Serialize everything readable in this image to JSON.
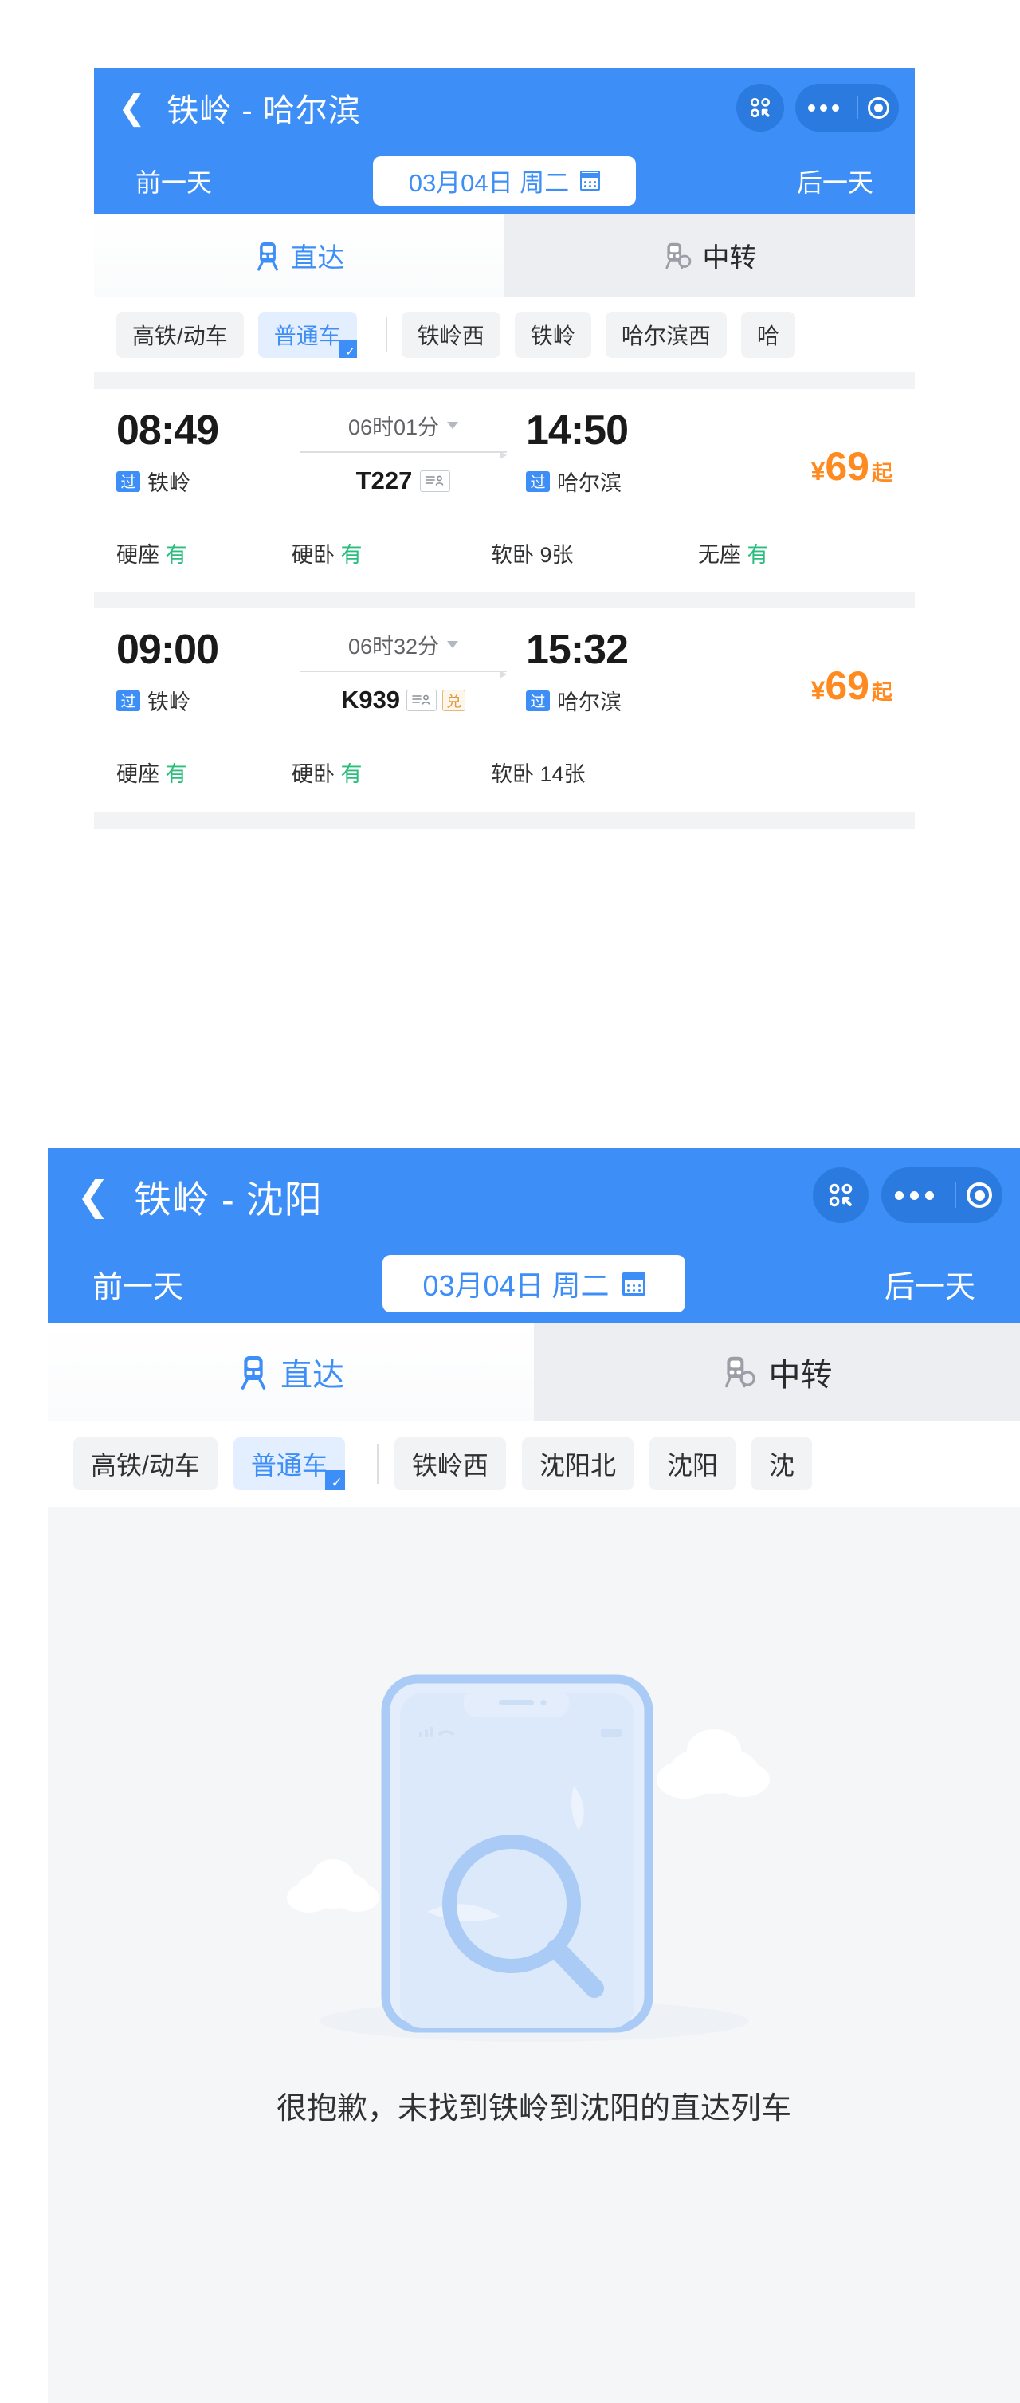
{
  "screens": [
    {
      "id": "harbin",
      "header": {
        "back_icon": "chevron-left-icon",
        "title": "铁岭 - 哈尔滨",
        "capsule": {
          "menu_icon": "mini-program-menu-icon",
          "more_icon": "more-dots-icon",
          "close_icon": "target-circle-icon"
        }
      },
      "date_bar": {
        "prev_label": "前一天",
        "date_label": "03月04日 周二",
        "calendar_icon": "calendar-icon",
        "next_label": "后一天"
      },
      "tabs": [
        {
          "label": "直达",
          "icon": "train-front-icon",
          "active": true
        },
        {
          "label": "中转",
          "icon": "train-transfer-icon",
          "active": false
        }
      ],
      "filters": [
        {
          "label": "高铁/动车",
          "selected": false
        },
        {
          "label": "普通车",
          "selected": true
        },
        {
          "divider": true
        },
        {
          "label": "铁岭西",
          "selected": false
        },
        {
          "label": "铁岭",
          "selected": false
        },
        {
          "label": "哈尔滨西",
          "selected": false
        },
        {
          "label": "哈",
          "selected": false,
          "clipped": true
        }
      ],
      "trains": [
        {
          "depart_time": "08:49",
          "depart_pass": "过",
          "depart_station": "铁岭",
          "duration": "06时01分",
          "train_no": "T227",
          "badges": [
            "id-card-icon"
          ],
          "arrive_time": "14:50",
          "arrive_pass": "过",
          "arrive_station": "哈尔滨",
          "price_symbol": "¥",
          "price": "69",
          "price_suffix": "起",
          "seats": [
            {
              "name": "硬座",
              "status": "有",
              "available": true
            },
            {
              "name": "硬卧",
              "status": "有",
              "available": true
            },
            {
              "name": "软卧",
              "status": "9张",
              "available": false
            },
            {
              "name": "无座",
              "status": "有",
              "available": true
            }
          ]
        },
        {
          "depart_time": "09:00",
          "depart_pass": "过",
          "depart_station": "铁岭",
          "duration": "06时32分",
          "train_no": "K939",
          "badges": [
            "id-card-icon",
            "exchange-icon"
          ],
          "arrive_time": "15:32",
          "arrive_pass": "过",
          "arrive_station": "哈尔滨",
          "price_symbol": "¥",
          "price": "69",
          "price_suffix": "起",
          "seats": [
            {
              "name": "硬座",
              "status": "有",
              "available": true
            },
            {
              "name": "硬卧",
              "status": "有",
              "available": true
            },
            {
              "name": "软卧",
              "status": "14张",
              "available": false
            }
          ]
        }
      ]
    },
    {
      "id": "shenyang",
      "header": {
        "back_icon": "chevron-left-icon",
        "title": "铁岭 - 沈阳",
        "capsule": {
          "menu_icon": "mini-program-menu-icon",
          "more_icon": "more-dots-icon",
          "close_icon": "target-circle-icon"
        }
      },
      "date_bar": {
        "prev_label": "前一天",
        "date_label": "03月04日 周二",
        "calendar_icon": "calendar-icon",
        "next_label": "后一天"
      },
      "tabs": [
        {
          "label": "直达",
          "icon": "train-front-icon",
          "active": true
        },
        {
          "label": "中转",
          "icon": "train-transfer-icon",
          "active": false
        }
      ],
      "filters": [
        {
          "label": "高铁/动车",
          "selected": false
        },
        {
          "label": "普通车",
          "selected": true
        },
        {
          "divider": true
        },
        {
          "label": "铁岭西",
          "selected": false
        },
        {
          "label": "沈阳北",
          "selected": false
        },
        {
          "label": "沈阳",
          "selected": false
        },
        {
          "label": "沈",
          "selected": false,
          "clipped": true
        }
      ],
      "trains": [],
      "empty_state": {
        "illustration": "phone-search-empty-illustration",
        "message": "很抱歉，未找到铁岭到沈阳的直达列车"
      }
    }
  ],
  "colors": {
    "brand_blue": "#3d8ef7",
    "capsule_blue": "#2b7ae0",
    "chip_selected_bg": "#e3efff",
    "price_orange": "#ff8a1f",
    "available_green": "#2bbd7e",
    "page_bg": "#f5f6f7"
  }
}
